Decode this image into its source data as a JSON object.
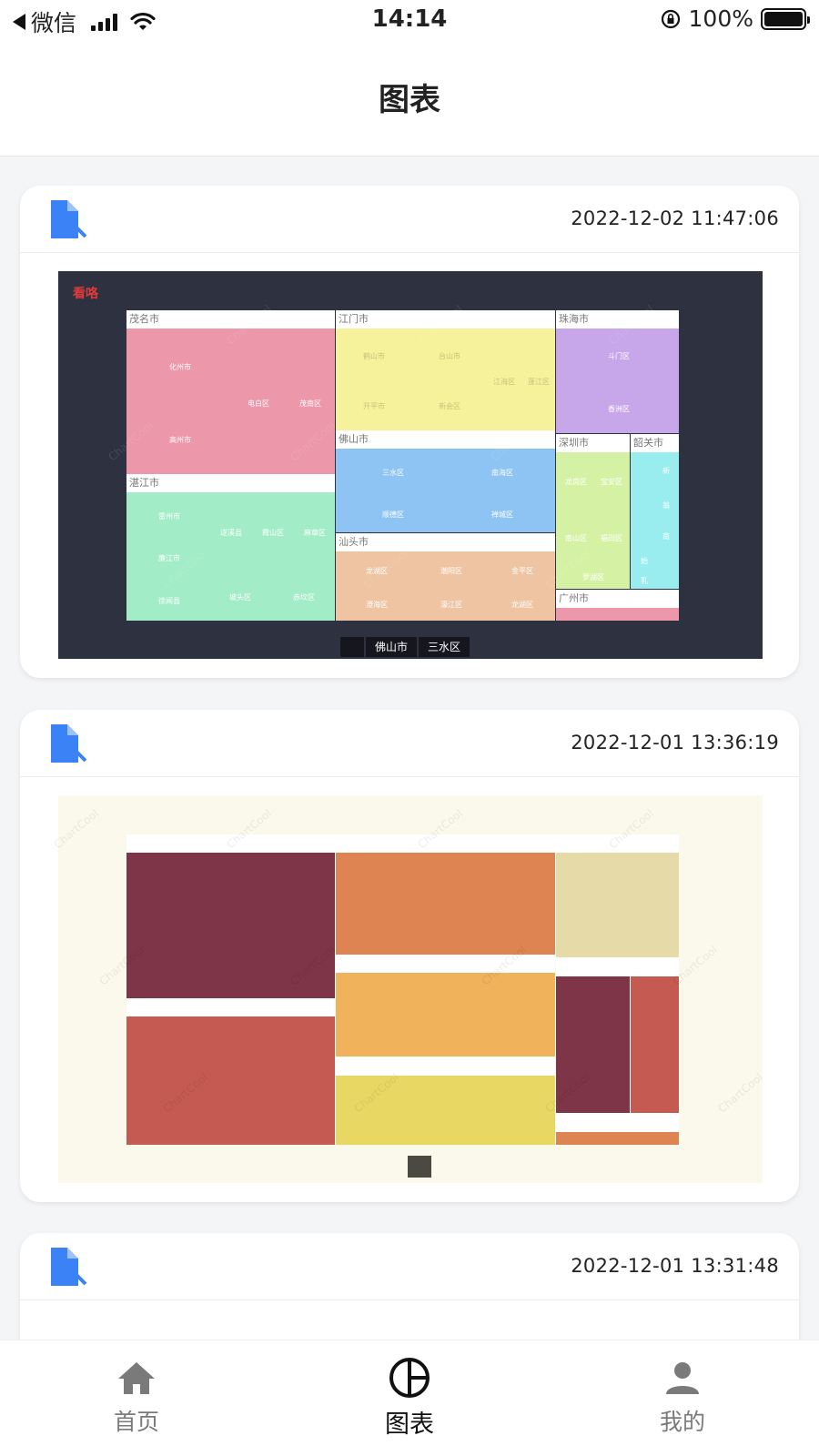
{
  "status_bar": {
    "back_app": "微信",
    "time": "14:14",
    "battery": "100%",
    "battery_level": 1.0
  },
  "nav": {
    "title": "图表"
  },
  "cards": [
    {
      "date": "2022-12-02 11:47:06",
      "chart": {
        "title": "看咯",
        "groups": [
          "茂名市",
          "江门市",
          "珠海市",
          "湛江市",
          "佛山市",
          "汕头市",
          "深圳市",
          "韶关市",
          "广州市"
        ],
        "breadcrumb": [
          "佛山市",
          "三水区"
        ],
        "watermark": "ChartCool",
        "labels": {
          "maoming": [
            "化州市",
            "电白区",
            "茂南区",
            "高州市"
          ],
          "jiangmen": [
            "鹤山市",
            "台山市",
            "江海区",
            "蓬江区",
            "开平市",
            "新会区"
          ],
          "zhuhai": [
            "斗门区",
            "香洲区"
          ],
          "zhanjiang": [
            "雷州市",
            "遂溪县",
            "霞山区",
            "廉江市",
            "麻章区",
            "赤坎区",
            "徐闻县",
            "坡头区"
          ],
          "foshan": [
            "三水区",
            "南海区",
            "顺德区",
            "禅城区"
          ],
          "shantou": [
            "龙湖区",
            "潮阳区",
            "金平区",
            "澄海区",
            "濠江区",
            "龙湖区"
          ],
          "shenzhen": [
            "龙岗区",
            "宝安区",
            "南山区",
            "福田区",
            "罗湖区"
          ],
          "shaoguan": [
            "新",
            "翁",
            "南",
            "始",
            "乳"
          ]
        }
      }
    },
    {
      "date": "2022-12-01 13:36:19",
      "chart": {
        "watermark": "ChartCool"
      }
    },
    {
      "date": "2022-12-01 13:31:48"
    }
  ],
  "tabs": [
    {
      "label": "首页",
      "icon": "home-icon"
    },
    {
      "label": "图表",
      "icon": "chart-pie-icon"
    },
    {
      "label": "我的",
      "icon": "user-icon"
    }
  ],
  "colors": {
    "icon_blue": "#3b82f6",
    "chart1_bg": "#2e3140",
    "chart2_bg": "#fbf9ec",
    "active_tab": "#111111",
    "inactive_tab": "#7a7a7a"
  }
}
